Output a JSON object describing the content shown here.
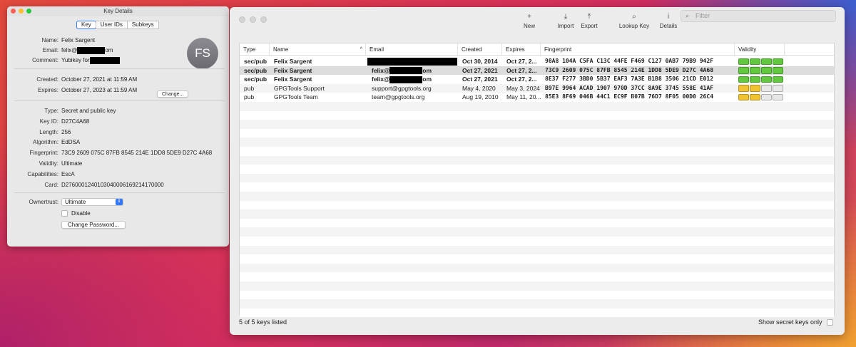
{
  "key_details": {
    "title": "Key Details",
    "tabs": [
      "Key",
      "User IDs",
      "Subkeys"
    ],
    "avatar_initials": "FS",
    "name_label": "Name:",
    "name": "Felix Sargent",
    "email_label": "Email:",
    "email_prefix": "felix@",
    "email_suffix": "om",
    "comment_label": "Comment:",
    "comment_prefix": "Yubikey for",
    "created_label": "Created:",
    "created": "October 27, 2021 at 11:59 AM",
    "expires_label": "Expires:",
    "expires": "October 27, 2023 at 11:59 AM",
    "change_button": "Change...",
    "type_label": "Type:",
    "type": "Secret and public key",
    "keyid_label": "Key ID:",
    "keyid": "D27C4A68",
    "length_label": "Length:",
    "length": "256",
    "algorithm_label": "Algorithm:",
    "algorithm": "EdDSA",
    "fingerprint_label": "Fingerprint:",
    "fingerprint": "73C9 2609 075C 87FB 8545  214E 1DD8 5DE9 D27C 4A68",
    "validity_label": "Validity:",
    "validity": "Ultimate",
    "capabilities_label": "Capabilities:",
    "capabilities": "EscA",
    "card_label": "Card:",
    "card": "D2760001240103040006169214170000",
    "ownertrust_label": "Ownertrust:",
    "ownertrust": "Ultimate",
    "disable_label": "Disable",
    "change_password_button": "Change Password..."
  },
  "main": {
    "toolbar": {
      "new": "New",
      "new_icon": "plus-icon",
      "import": "Import",
      "import_icon": "import-icon",
      "export": "Export",
      "export_icon": "export-icon",
      "lookup": "Lookup Key",
      "lookup_icon": "magnifier-icon",
      "details": "Details",
      "details_icon": "info-icon",
      "filter_placeholder": "Filter"
    },
    "columns": {
      "type": "Type",
      "name": "Name",
      "email": "Email",
      "created": "Created",
      "expires": "Expires",
      "fingerprint": "Fingerprint",
      "validity": "Validity"
    },
    "rows": [
      {
        "type": "sec/pub",
        "name": "Felix Sargent",
        "email_prefix": "",
        "email_suffix": "",
        "created": "Oct 30, 2014",
        "expires": "Oct 27, 2...",
        "fingerprint": "98A8 104A C5FA C13C 44FE  F469 C127 0AB7 79B9 942F",
        "validity": [
          1,
          1,
          1,
          1
        ],
        "color": "g"
      },
      {
        "type": "sec/pub",
        "name": "Felix Sargent",
        "email_prefix": "felix@",
        "email_suffix": "om",
        "created": "Oct 27, 2021",
        "expires": "Oct 27, 2...",
        "fingerprint": "73C9 2609 075C 87FB 8545  214E 1DD8 5DE9 D27C 4A68",
        "validity": [
          1,
          1,
          1,
          1
        ],
        "color": "g"
      },
      {
        "type": "sec/pub",
        "name": "Felix Sargent",
        "email_prefix": "felix@",
        "email_suffix": "om",
        "created": "Oct 27, 2021",
        "expires": "Oct 27, 2...",
        "fingerprint": "8E37 F277 3BD0 5B37 EAF3  7A3E B1B8 3506 21CD E012",
        "validity": [
          1,
          1,
          1,
          1
        ],
        "color": "g"
      },
      {
        "type": "pub",
        "name": "GPGTools Support",
        "email_prefix": "support@gpgtools.org",
        "email_suffix": "",
        "created": "May 4, 2020",
        "expires": "May 3, 2024",
        "fingerprint": "B97E 9964 ACAD 1907 970D  37CC 8A9E 3745 558E 41AF",
        "validity": [
          1,
          1,
          0,
          0
        ],
        "color": "y"
      },
      {
        "type": "pub",
        "name": "GPGTools Team",
        "email_prefix": "team@gpgtools.org",
        "email_suffix": "",
        "created": "Aug 19, 2010",
        "expires": "May 11, 20...",
        "fingerprint": "85E3 8F69 046B 44C1 EC9F  B07B 76D7 8F05 00D0 26C4",
        "validity": [
          1,
          1,
          0,
          0
        ],
        "color": "y"
      }
    ],
    "status": "5 of 5 keys listed",
    "show_secret_only": "Show secret keys only",
    "colors": {
      "green": "#62c840",
      "yellow": "#f1c232",
      "selection": "#dcdcdc"
    }
  }
}
